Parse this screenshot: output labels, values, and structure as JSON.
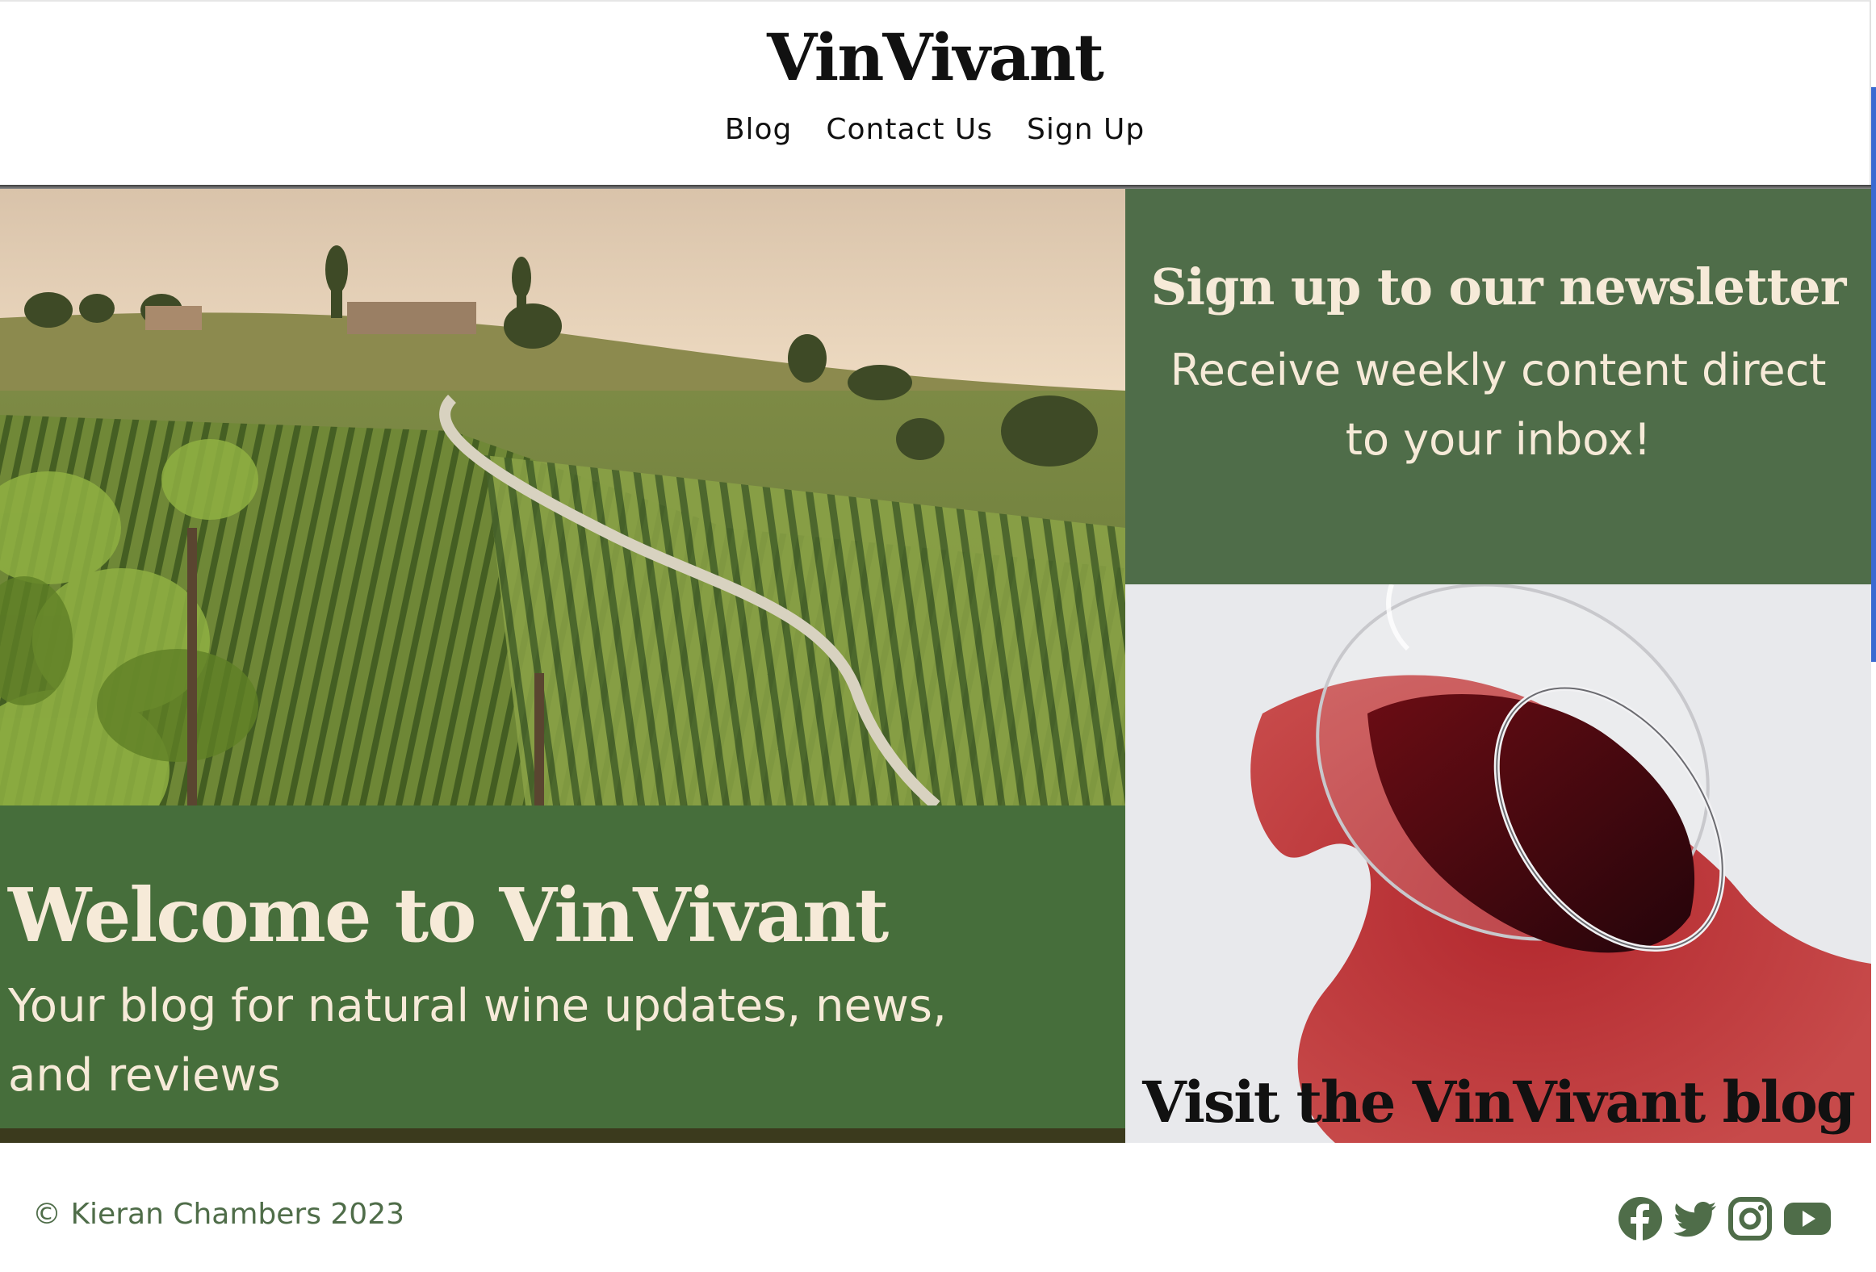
{
  "header": {
    "logo": "VinVivant",
    "nav": [
      "Blog",
      "Contact Us",
      "Sign Up"
    ]
  },
  "hero": {
    "title": "Welcome to VinVivant",
    "subtitle": "Your blog for natural wine updates, news, and reviews"
  },
  "newsletter": {
    "title": "Sign up to our newsletter",
    "text": "Receive weekly content direct to your inbox!"
  },
  "blog_card": {
    "link_text": "Visit the VinVivant blog"
  },
  "footer": {
    "copyright": "© Kieran Chambers 2023",
    "social_icons": [
      "facebook-icon",
      "twitter-icon",
      "instagram-icon",
      "youtube-icon"
    ]
  },
  "colors": {
    "brand_green": "#4f6d49",
    "cream_text": "#f6ead8",
    "wine_red": "#a8262c"
  }
}
